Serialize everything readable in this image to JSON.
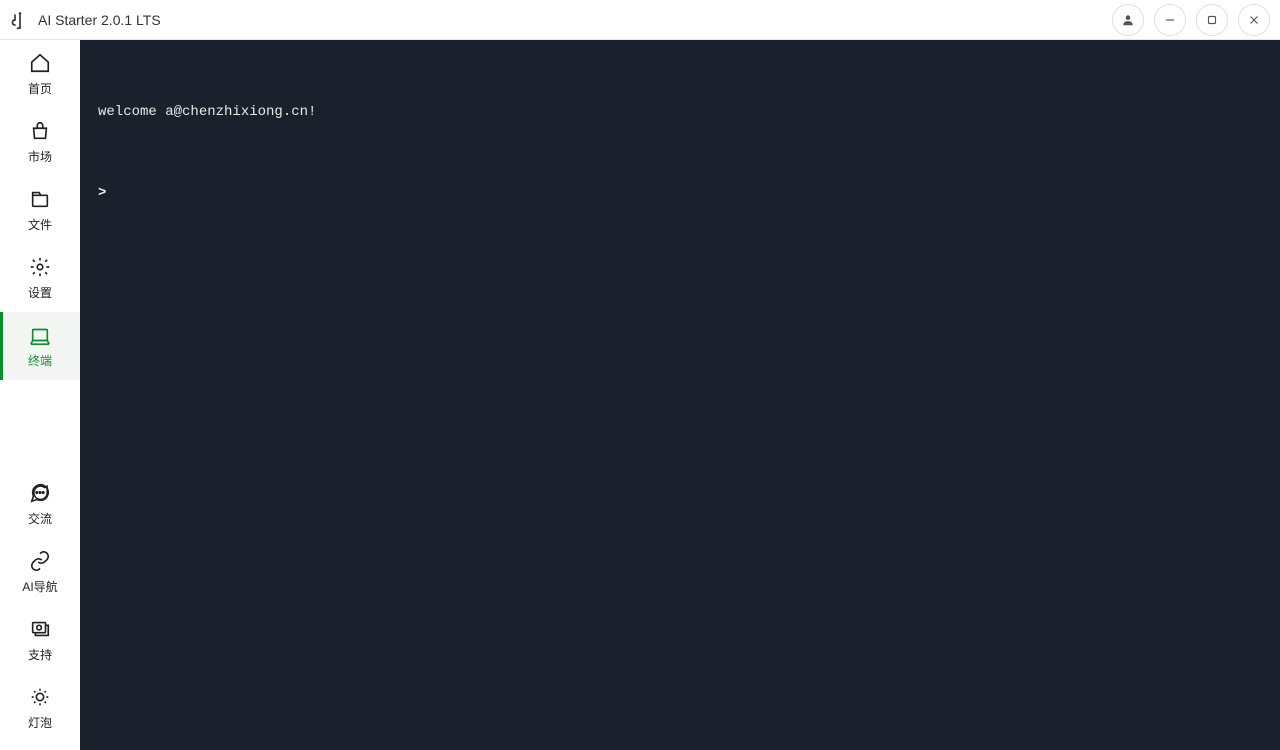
{
  "titlebar": {
    "title": "AI Starter 2.0.1 LTS"
  },
  "window_controls": {
    "user": "user",
    "minimize": "minimize",
    "maximize": "maximize",
    "close": "close"
  },
  "sidebar": {
    "top": [
      {
        "icon": "home-icon",
        "label": "首页"
      },
      {
        "icon": "market-icon",
        "label": "市场"
      },
      {
        "icon": "files-icon",
        "label": "文件"
      },
      {
        "icon": "settings-icon",
        "label": "设置"
      },
      {
        "icon": "terminal-icon",
        "label": "终端",
        "active": true
      }
    ],
    "bottom": [
      {
        "icon": "chat-icon",
        "label": "交流"
      },
      {
        "icon": "link-icon",
        "label": "AI导航"
      },
      {
        "icon": "support-icon",
        "label": "支持"
      },
      {
        "icon": "bulb-icon",
        "label": "灯泡"
      }
    ]
  },
  "terminal": {
    "welcome_line": "welcome a@chenzhixiong.cn!",
    "prompt": ">",
    "input_value": ""
  }
}
